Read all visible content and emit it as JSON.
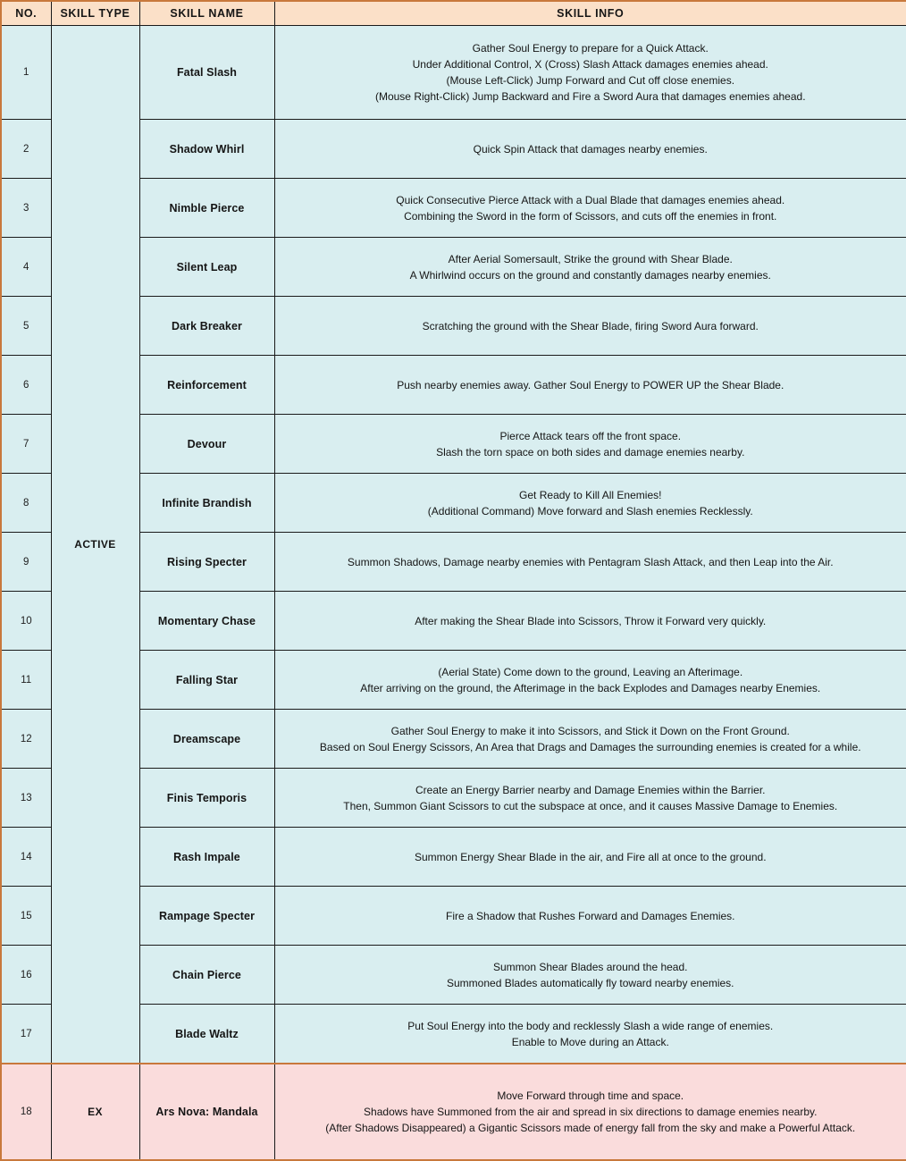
{
  "table": {
    "columns": [
      {
        "key": "no",
        "label": "NO."
      },
      {
        "key": "type",
        "label": "SKILL TYPE"
      },
      {
        "key": "name",
        "label": "SKILL NAME"
      },
      {
        "key": "info",
        "label": "SKILL INFO"
      }
    ],
    "groups": [
      {
        "key": "active",
        "label": "ACTIVE",
        "row_count": 17
      },
      {
        "key": "ex",
        "label": "EX",
        "row_count": 1
      }
    ],
    "colors": {
      "header_background": "#FBE0C8",
      "active_row_background": "#D9EEF0",
      "ex_row_background": "#FADCDC",
      "outer_border": "#C8783C",
      "inner_border": "#1A1A1A",
      "text": "#151515"
    },
    "rows": [
      {
        "no": "1",
        "type": "ACTIVE",
        "name": "Fatal Slash",
        "info": [
          "Gather Soul Energy to prepare for a Quick Attack.",
          "Under Additional Control, X (Cross) Slash Attack damages enemies ahead.",
          "(Mouse Left-Click) Jump Forward and Cut off close enemies.",
          "(Mouse Right-Click) Jump Backward and Fire a Sword Aura that damages enemies ahead."
        ]
      },
      {
        "no": "2",
        "type": "ACTIVE",
        "name": "Shadow Whirl",
        "info": [
          "Quick Spin Attack that damages nearby enemies."
        ]
      },
      {
        "no": "3",
        "type": "ACTIVE",
        "name": "Nimble Pierce",
        "info": [
          "Quick Consecutive Pierce Attack with a Dual Blade that damages enemies ahead.",
          "Combining the Sword in the form of Scissors, and cuts off the enemies in front."
        ]
      },
      {
        "no": "4",
        "type": "ACTIVE",
        "name": "Silent Leap",
        "info": [
          "After Aerial Somersault, Strike the ground with Shear Blade.",
          "A Whirlwind occurs on the ground and constantly damages nearby enemies."
        ]
      },
      {
        "no": "5",
        "type": "ACTIVE",
        "name": "Dark Breaker",
        "info": [
          "Scratching the ground with the Shear Blade, firing Sword Aura forward."
        ]
      },
      {
        "no": "6",
        "type": "ACTIVE",
        "name": "Reinforcement",
        "info": [
          "Push nearby enemies away. Gather Soul Energy to POWER UP the Shear Blade."
        ]
      },
      {
        "no": "7",
        "type": "ACTIVE",
        "name": "Devour",
        "info": [
          "Pierce Attack tears off the front space.",
          "Slash the torn space on both sides and damage enemies nearby."
        ]
      },
      {
        "no": "8",
        "type": "ACTIVE",
        "name": "Infinite Brandish",
        "info": [
          "Get Ready to Kill All Enemies!",
          "(Additional Command) Move forward and Slash enemies Recklessly."
        ]
      },
      {
        "no": "9",
        "type": "ACTIVE",
        "name": "Rising Specter",
        "info": [
          "Summon Shadows, Damage nearby enemies with Pentagram Slash Attack, and then Leap into the Air."
        ]
      },
      {
        "no": "10",
        "type": "ACTIVE",
        "name": "Momentary Chase",
        "info": [
          "After making the Shear Blade into Scissors, Throw it Forward very quickly."
        ]
      },
      {
        "no": "11",
        "type": "ACTIVE",
        "name": "Falling Star",
        "info": [
          "(Aerial State) Come down to the ground, Leaving an Afterimage.",
          "After arriving on the ground, the Afterimage in the back Explodes and Damages nearby Enemies."
        ]
      },
      {
        "no": "12",
        "type": "ACTIVE",
        "name": "Dreamscape",
        "info": [
          "Gather Soul Energy to make it into Scissors, and Stick it Down on the Front Ground.",
          "Based on Soul Energy Scissors, An Area that Drags and Damages the surrounding enemies is created for a while."
        ]
      },
      {
        "no": "13",
        "type": "ACTIVE",
        "name": "Finis Temporis",
        "info": [
          "Create an Energy Barrier nearby and Damage Enemies within the Barrier.",
          "Then, Summon Giant Scissors to cut the subspace at once, and it causes Massive Damage to Enemies."
        ]
      },
      {
        "no": "14",
        "type": "ACTIVE",
        "name": "Rash Impale",
        "info": [
          "Summon Energy Shear Blade in the air, and Fire all at once to the ground."
        ]
      },
      {
        "no": "15",
        "type": "ACTIVE",
        "name": "Rampage Specter",
        "info": [
          "Fire a Shadow that Rushes Forward and Damages Enemies."
        ]
      },
      {
        "no": "16",
        "type": "ACTIVE",
        "name": "Chain Pierce",
        "info": [
          "Summon Shear Blades around the head.",
          "Summoned Blades automatically fly toward nearby enemies."
        ]
      },
      {
        "no": "17",
        "type": "ACTIVE",
        "name": "Blade Waltz",
        "info": [
          "Put Soul Energy into the body and recklessly Slash a wide range of enemies.",
          "Enable to Move during an Attack."
        ]
      },
      {
        "no": "18",
        "type": "EX",
        "name": "Ars Nova: Mandala",
        "info": [
          "Move Forward through time and space.",
          "Shadows have Summoned from the air and spread in six directions to damage enemies nearby.",
          "(After Shadows Disappeared) a Gigantic Scissors made of energy fall from the sky and make a Powerful Attack."
        ]
      }
    ]
  }
}
